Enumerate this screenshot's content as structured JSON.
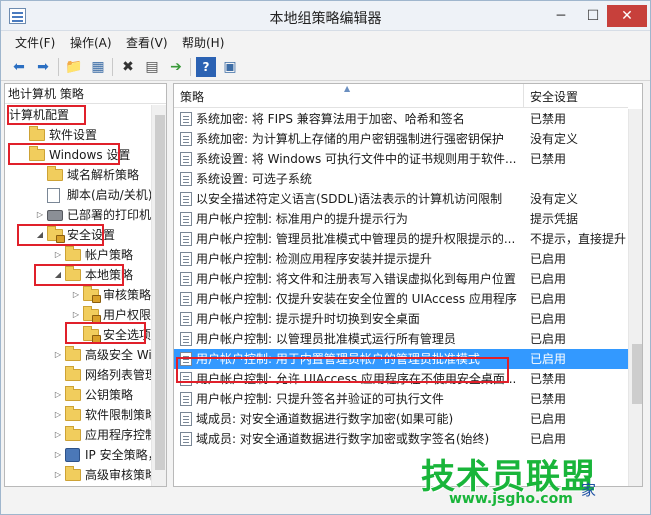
{
  "window": {
    "title": "本地组策略编辑器",
    "minimize_glyph": "─",
    "maximize_glyph": "☐",
    "close_glyph": "✕"
  },
  "menu": [
    "文件(F)",
    "操作(A)",
    "查看(V)",
    "帮助(H)"
  ],
  "toolbar": {
    "icons": [
      "back-arrow-icon",
      "forward-arrow-icon",
      "up-folder-icon",
      "show-hide-tree-icon",
      "delete-icon",
      "properties-icon",
      "export-list-icon",
      "help-icon",
      "extended-view-icon"
    ],
    "glyphs": [
      "⬅",
      "➡",
      "📁",
      "▦",
      "✖",
      "▤",
      "➔",
      "?",
      "▣"
    ]
  },
  "tree": {
    "header": "地计算机 策略",
    "items": [
      {
        "label": "计算机配置",
        "level": 0,
        "icon": "none",
        "twisty": ""
      },
      {
        "label": "软件设置",
        "level": 1,
        "icon": "folder-icon",
        "twisty": ""
      },
      {
        "label": "Windows 设置",
        "level": 1,
        "icon": "folder-icon",
        "twisty": ""
      },
      {
        "label": "域名解析策略",
        "level": 2,
        "icon": "folder-icon",
        "twisty": ""
      },
      {
        "label": "脚本(启动/关机)",
        "level": 2,
        "icon": "script-icon",
        "twisty": ""
      },
      {
        "label": "已部署的打印机",
        "level": 2,
        "icon": "printer-icon",
        "twisty": "▷"
      },
      {
        "label": "安全设置",
        "level": 2,
        "icon": "folder-lock-icon",
        "twisty": "◢"
      },
      {
        "label": "帐户策略",
        "level": 3,
        "icon": "folder-icon",
        "twisty": "▷"
      },
      {
        "label": "本地策略",
        "level": 3,
        "icon": "folder-icon",
        "twisty": "◢"
      },
      {
        "label": "审核策略",
        "level": 4,
        "icon": "folder-lock-icon",
        "twisty": "▷"
      },
      {
        "label": "用户权限分",
        "level": 4,
        "icon": "folder-lock-icon",
        "twisty": "▷"
      },
      {
        "label": "安全选项",
        "level": 4,
        "icon": "folder-lock-icon",
        "twisty": ""
      },
      {
        "label": "高级安全 Wind",
        "level": 3,
        "icon": "folder-icon",
        "twisty": "▷"
      },
      {
        "label": "网络列表管理器",
        "level": 3,
        "icon": "folder-icon",
        "twisty": ""
      },
      {
        "label": "公钥策略",
        "level": 3,
        "icon": "folder-icon",
        "twisty": "▷"
      },
      {
        "label": "软件限制策略",
        "level": 3,
        "icon": "folder-icon",
        "twisty": "▷"
      },
      {
        "label": "应用程序控制策",
        "level": 3,
        "icon": "folder-icon",
        "twisty": "▷"
      },
      {
        "label": "IP 安全策略，i",
        "level": 3,
        "icon": "network-icon",
        "twisty": "▷"
      },
      {
        "label": "高级审核策略配",
        "level": 3,
        "icon": "folder-icon",
        "twisty": "▷"
      }
    ]
  },
  "list": {
    "columns": [
      "策略",
      "安全设置"
    ],
    "sort_glyph": "▲",
    "rows": [
      {
        "name": "系统加密: 将 FIPS 兼容算法用于加密、哈希和签名",
        "value": "已禁用"
      },
      {
        "name": "系统加密: 为计算机上存储的用户密钥强制进行强密钥保护",
        "value": "没有定义"
      },
      {
        "name": "系统设置: 将 Windows 可执行文件中的证书规则用于软件...",
        "value": "已禁用"
      },
      {
        "name": "系统设置: 可选子系统",
        "value": ""
      },
      {
        "name": "以安全描述符定义语言(SDDL)语法表示的计算机访问限制",
        "value": "没有定义"
      },
      {
        "name": "用户帐户控制: 标准用户的提升提示行为",
        "value": "提示凭据"
      },
      {
        "name": "用户帐户控制: 管理员批准模式中管理员的提升权限提示的...",
        "value": "不提示，直接提升"
      },
      {
        "name": "用户帐户控制: 检测应用程序安装并提示提升",
        "value": "已启用"
      },
      {
        "name": "用户帐户控制: 将文件和注册表写入错误虚拟化到每用户位置",
        "value": "已启用"
      },
      {
        "name": "用户帐户控制: 仅提升安装在安全位置的 UIAccess 应用程序",
        "value": "已启用"
      },
      {
        "name": "用户帐户控制: 提示提升时切换到安全桌面",
        "value": "已启用"
      },
      {
        "name": "用户帐户控制: 以管理员批准模式运行所有管理员",
        "value": "已启用"
      },
      {
        "name": "用户帐户控制: 用于内置管理员帐户的管理员批准模式",
        "value": "已启用",
        "selected": true
      },
      {
        "name": "用户帐户控制: 允许 UIAccess 应用程序在不使用安全桌面...",
        "value": "已禁用"
      },
      {
        "name": "用户帐户控制: 只提升签名并验证的可执行文件",
        "value": "已禁用"
      },
      {
        "name": "域成员: 对安全通道数据进行数字加密(如果可能)",
        "value": "已启用"
      },
      {
        "name": "域成员: 对安全通道数据进行数字加密或数字签名(始终)",
        "value": "已启用"
      }
    ]
  },
  "watermark": {
    "main": "技术员联盟",
    "sub": "www.jsgho.com",
    "tail": "家"
  },
  "colors": {
    "selection": "#3399ff",
    "annotation": "#e0202a",
    "watermark": "#19b53a"
  }
}
